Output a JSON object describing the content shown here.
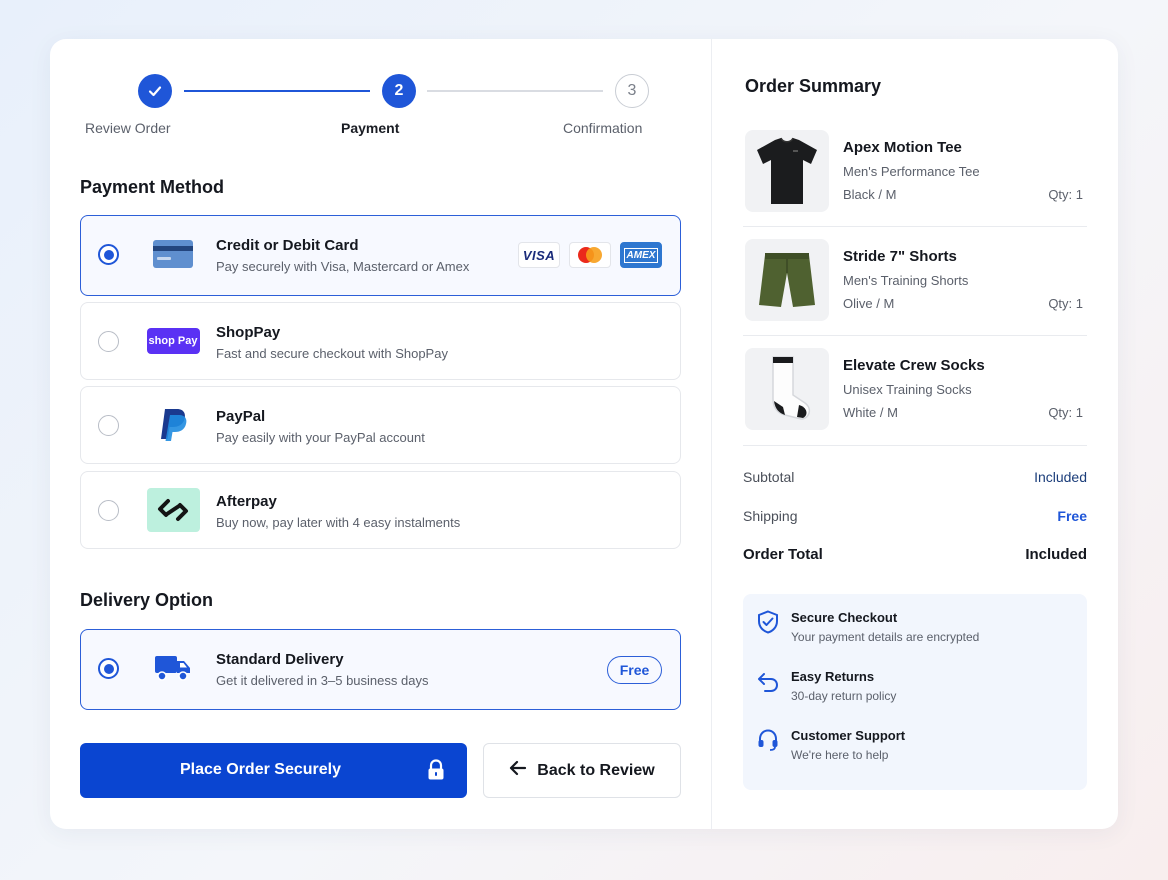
{
  "stepper": {
    "steps": [
      {
        "label": "Review Order",
        "state": "done"
      },
      {
        "label": "Payment",
        "number": "2",
        "state": "active"
      },
      {
        "label": "Confirmation",
        "number": "3",
        "state": "todo"
      }
    ]
  },
  "payment": {
    "title": "Payment Method",
    "options": [
      {
        "title": "Credit or Debit Card",
        "desc": "Pay securely with Visa, Mastercard or Amex",
        "selected": true,
        "icon": "credit-card-icon"
      },
      {
        "title": "ShopPay",
        "desc": "Fast and secure checkout with ShopPay",
        "selected": false,
        "icon": "shoppay-logo"
      },
      {
        "title": "PayPal",
        "desc": "Pay easily with your PayPal account",
        "selected": false,
        "icon": "paypal-logo"
      },
      {
        "title": "Afterpay",
        "desc": "Buy now, pay later with 4 easy instalments",
        "selected": false,
        "icon": "afterpay-logo"
      }
    ],
    "brands": {
      "visa": "VISA",
      "amex": "AMEX"
    },
    "shoppay_logo_text": "shop Pay"
  },
  "delivery": {
    "title": "Delivery Option",
    "option": {
      "title": "Standard Delivery",
      "desc": "Get it delivered in 3–5 business days",
      "badge": "Free",
      "selected": true,
      "icon": "truck-icon"
    }
  },
  "actions": {
    "place_order": "Place Order Securely",
    "back": "Back to Review"
  },
  "summary": {
    "title": "Order Summary",
    "items": [
      {
        "name": "Apex Motion Tee",
        "sub": "Men's Performance Tee",
        "variant": "Black / M",
        "qty": "Qty: 1"
      },
      {
        "name": "Stride 7\" Shorts",
        "sub": "Men's Training Shorts",
        "variant": "Olive / M",
        "qty": "Qty: 1"
      },
      {
        "name": "Elevate Crew Socks",
        "sub": "Unisex Training Socks",
        "variant": "White / M",
        "qty": "Qty: 1"
      }
    ],
    "subtotal_label": "Subtotal",
    "subtotal_value": "Included",
    "shipping_label": "Shipping",
    "shipping_value": "Free",
    "total_label": "Order Total",
    "total_value": "Included"
  },
  "trust": [
    {
      "title": "Secure Checkout",
      "desc": "Your payment details are encrypted",
      "icon": "shield-check-icon"
    },
    {
      "title": "Easy Returns",
      "desc": "30-day return policy",
      "icon": "return-arrow-icon"
    },
    {
      "title": "Customer Support",
      "desc": "We're here to help",
      "icon": "headset-icon"
    }
  ],
  "colors": {
    "accent": "#1f56d8",
    "primary_button": "#0a45d1",
    "olive": "#4f6130"
  }
}
